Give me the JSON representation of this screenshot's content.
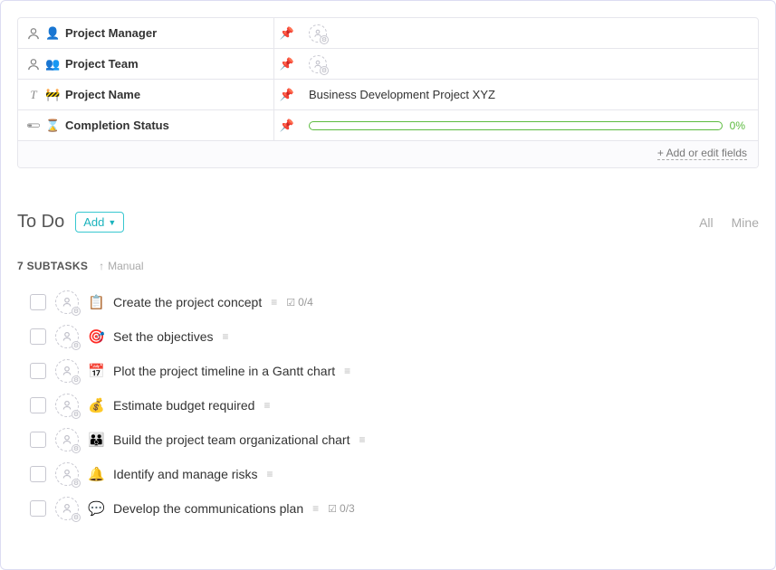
{
  "fields": [
    {
      "type_icon": "person",
      "emoji": "👤",
      "label": "Project Manager",
      "value_kind": "avatar",
      "value": "",
      "emoji_color": "#6b4fb5"
    },
    {
      "type_icon": "person",
      "emoji": "👥",
      "label": "Project Team",
      "value_kind": "avatar",
      "value": "",
      "emoji_color": "#6b4fb5"
    },
    {
      "type_icon": "text",
      "emoji": "🚧",
      "label": "Project Name",
      "value_kind": "text",
      "value": "Business Development Project XYZ",
      "emoji_color": ""
    },
    {
      "type_icon": "progress",
      "emoji": "⌛",
      "label": "Completion Status",
      "value_kind": "progress",
      "value": "0%",
      "emoji_color": ""
    }
  ],
  "fields_footer": {
    "add_edit": "+ Add or edit fields"
  },
  "section": {
    "title": "To Do",
    "add_label": "Add",
    "filters": {
      "all": "All",
      "mine": "Mine"
    }
  },
  "subtasks": {
    "count_label": "7 SUBTASKS",
    "sort_label": "Manual"
  },
  "tasks": [
    {
      "emoji": "📋",
      "title": "Create the project concept",
      "progress": "0/4"
    },
    {
      "emoji": "🎯",
      "title": "Set the objectives",
      "progress": ""
    },
    {
      "emoji": "📅",
      "title": "Plot the project timeline in a Gantt chart",
      "progress": ""
    },
    {
      "emoji": "💰",
      "title": "Estimate budget required",
      "progress": ""
    },
    {
      "emoji": "👪",
      "title": "Build the project team organizational chart",
      "progress": ""
    },
    {
      "emoji": "🔔",
      "title": "Identify and manage risks",
      "progress": ""
    },
    {
      "emoji": "💬",
      "title": "Develop the communications plan",
      "progress": "0/3"
    }
  ]
}
